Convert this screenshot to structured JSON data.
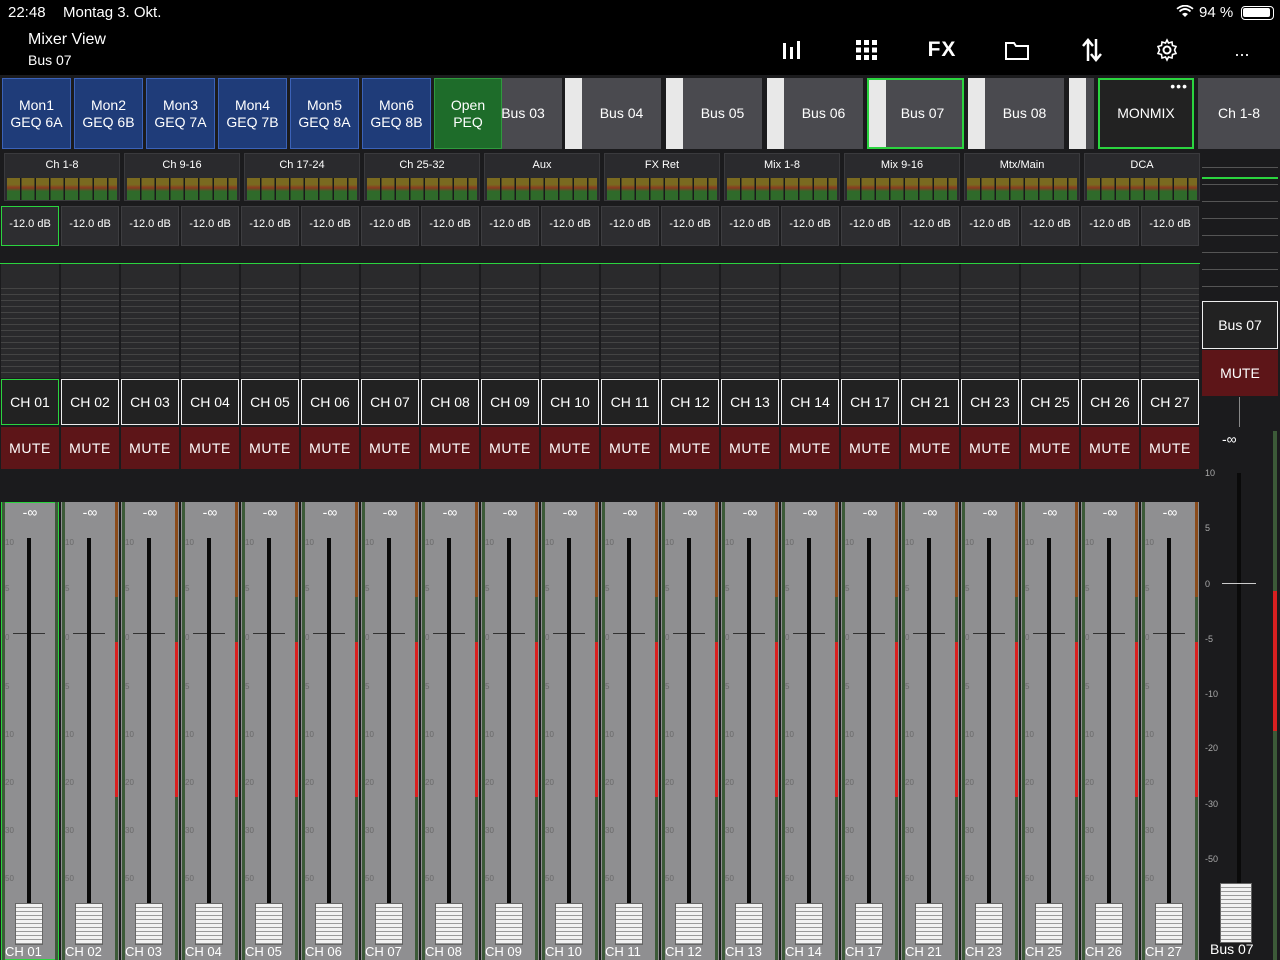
{
  "status": {
    "time": "22:48",
    "date": "Montag 3. Okt.",
    "battery": "94 %"
  },
  "title": {
    "view": "Mixer View",
    "subtitle": "Bus 07",
    "more": "..."
  },
  "toolbar_icons": [
    "mixer-icon",
    "grid-icon",
    "fx-icon",
    "folder-icon",
    "transfer-icon",
    "gear-icon"
  ],
  "toolbar": {
    "fx_label": "FX"
  },
  "buses": {
    "mon1": "Mon1\nGEQ 6A",
    "mon2": "Mon2\nGEQ 6B",
    "mon3": "Mon3\nGEQ 7A",
    "mon4": "Mon4\nGEQ 7B",
    "mon5": "Mon5\nGEQ 8A",
    "mon6": "Mon6\nGEQ 8B",
    "peq": "Open PEQ",
    "bus03": "Bus 03",
    "bus04": "Bus 04",
    "bus05": "Bus 05",
    "bus06": "Bus 06",
    "bus07": "Bus 07",
    "bus08": "Bus 08",
    "monmix": "MONMIX",
    "ch18": "Ch 1-8"
  },
  "layers": [
    "Ch 1-8",
    "Ch 9-16",
    "Ch 17-24",
    "Ch 25-32",
    "Aux",
    "FX Ret",
    "Mix 1-8",
    "Mix 9-16",
    "Mtx/Main",
    "DCA"
  ],
  "gain_label": "-12.0 dB",
  "mute_label": "MUTE",
  "fader_infinity": "-∞",
  "channels": [
    "CH 01",
    "CH 02",
    "CH 03",
    "CH 04",
    "CH 05",
    "CH 06",
    "CH 07",
    "CH 08",
    "CH 09",
    "CH 10",
    "CH 11",
    "CH 12",
    "CH 13",
    "CH 14",
    "CH 17",
    "CH 21",
    "CH 23",
    "CH 25",
    "CH 26",
    "CH 27"
  ],
  "strip_scale": [
    "10",
    "5",
    "0",
    "5",
    "10",
    "20",
    "30",
    "50"
  ],
  "master": {
    "name": "Bus 07",
    "mute": "MUTE",
    "infinity": "-∞",
    "label": "Bus 07",
    "scale": [
      "10",
      "5",
      "0",
      "-5",
      "-10",
      "-20",
      "-30",
      "-50"
    ]
  },
  "colors": {
    "accent": "#2bd43f",
    "mute": "#5d1518",
    "mon": "#1f3c79",
    "peq": "#1e6c2a"
  }
}
